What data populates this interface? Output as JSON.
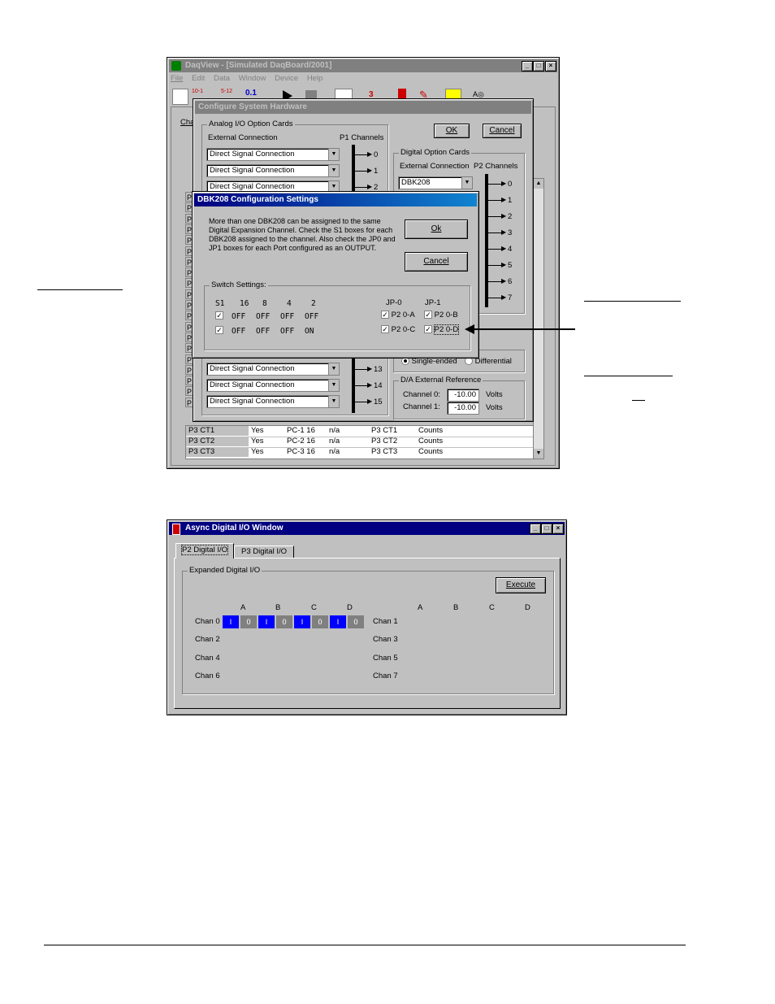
{
  "daqview": {
    "title": "DaqView - [Simulated DaqBoard/2001]",
    "menu": [
      "File",
      "Edit",
      "Data",
      "Window",
      "Device",
      "Help"
    ],
    "toolbar_icon_text": [
      "10-1",
      "5-12",
      "0.1"
    ],
    "tab_partial": "Cha",
    "grid_rows": [
      {
        "name": "P3 CT1",
        "on": "Yes",
        "type": "PC-1 16",
        "range": "n/a",
        "label": "P3 CT1",
        "units": "Counts"
      },
      {
        "name": "P3 CT2",
        "on": "Yes",
        "type": "PC-2 16",
        "range": "n/a",
        "label": "P3 CT2",
        "units": "Counts"
      },
      {
        "name": "P3 CT3",
        "on": "Yes",
        "type": "PC-3 16",
        "range": "n/a",
        "label": "P3 CT3",
        "units": "Counts"
      }
    ],
    "row_stub_letter": "P"
  },
  "config": {
    "title": "Configure System Hardware",
    "ok": "OK",
    "cancel": "Cancel",
    "analog_group": "Analog I/O Option Cards",
    "external_connection": "External Connection",
    "p1_channels": "P1 Channels",
    "analog_combos_top": [
      "Direct Signal Connection",
      "Direct Signal Connection",
      "Direct Signal Connection"
    ],
    "analog_nums_top": [
      "0",
      "1",
      "2"
    ],
    "analog_combos_bottom": [
      "Direct Signal Connection",
      "Direct Signal Connection",
      "Direct Signal Connection"
    ],
    "analog_nums_bottom": [
      "13",
      "14",
      "15"
    ],
    "digital_group": "Digital Option Cards",
    "digital_ext": "External Connection",
    "p2_channels": "P2 Channels",
    "digital_combo": "DBK208",
    "p2_nums": [
      "0",
      "1",
      "2",
      "3",
      "4",
      "5",
      "6",
      "7"
    ],
    "single_ended": "Single-ended",
    "differential": "Differential",
    "da_group": "D/A External Reference",
    "channel0": "Channel 0:",
    "channel1": "Channel 1:",
    "ch0_val": "-10.00",
    "ch1_val": "-10.00",
    "volts": "Volts"
  },
  "dbk": {
    "title": "DBK208 Configuration Settings",
    "message": "More than one DBK208 can be assigned to the same Digital Expansion Channel. Check the S1 boxes for each DBK208 assigned to the channel. Also check the JP0 and JP1 boxes for each Port configured as an OUTPUT.",
    "ok": "Ok",
    "cancel": "Cancel",
    "switch_group": "Switch Settings:",
    "headers": [
      "S1",
      "16",
      "8",
      "4",
      "2"
    ],
    "jp0": "JP-0",
    "jp1": "JP-1",
    "rows": [
      {
        "vals": [
          "OFF",
          "OFF",
          "OFF",
          "OFF"
        ],
        "jp0": "P2 0-A",
        "jp1": "P2 0-B"
      },
      {
        "vals": [
          "OFF",
          "OFF",
          "OFF",
          "ON"
        ],
        "jp0": "P2 0-C",
        "jp1": "P2 0-D"
      }
    ]
  },
  "async": {
    "title": "Async Digital I/O Window",
    "tabs": [
      "P2 Digital I/O",
      "P3 Digital I/O"
    ],
    "group": "Expanded Digital I/O",
    "execute": "Execute",
    "col_headers": [
      "A",
      "B",
      "C",
      "D"
    ],
    "left_chans": [
      "Chan 0",
      "Chan 2",
      "Chan 4",
      "Chan 6"
    ],
    "right_chans": [
      "Chan 1",
      "Chan 3",
      "Chan 5",
      "Chan 7"
    ],
    "bits": [
      "I",
      "0"
    ]
  },
  "colors": {
    "titlebar_active": "#000080",
    "titlebar_inactive": "#808080",
    "bit_input": "#0000ff",
    "bit_value": "#808080"
  }
}
